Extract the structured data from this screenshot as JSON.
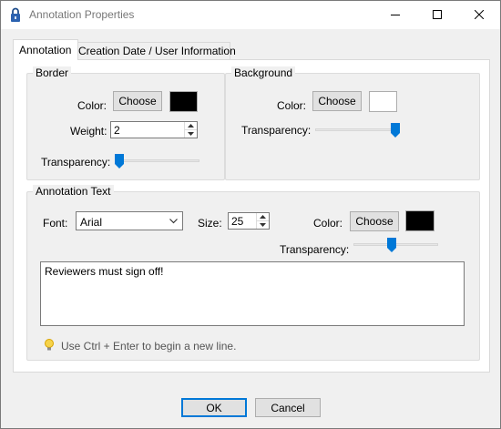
{
  "window": {
    "title": "Annotation Properties"
  },
  "tabs": [
    {
      "label": "Annotation",
      "active": true
    },
    {
      "label": "Creation Date / User Information",
      "active": false
    }
  ],
  "border": {
    "group_label": "Border",
    "color_label": "Color:",
    "choose_label": "Choose",
    "color_value": "#000000",
    "weight_label": "Weight:",
    "weight_value": "2",
    "transparency_label": "Transparency:",
    "transparency_level": 0.0
  },
  "background": {
    "group_label": "Background",
    "color_label": "Color:",
    "choose_label": "Choose",
    "color_value": "#ffffff",
    "transparency_label": "Transparency:",
    "transparency_level": 1.0
  },
  "annotation_text": {
    "group_label": "Annotation Text",
    "font_label": "Font:",
    "font_value": "Arial",
    "size_label": "Size:",
    "size_value": "25",
    "color_label": "Color:",
    "choose_label": "Choose",
    "color_value": "#000000",
    "transparency_label": "Transparency:",
    "transparency_level": 0.45,
    "text_value": "Reviewers must sign off!",
    "hint": "Use Ctrl + Enter to begin a new line.",
    "hint_icon": "lightbulb-icon"
  },
  "footer": {
    "ok_label": "OK",
    "cancel_label": "Cancel"
  },
  "colors": {
    "accent": "#0078d7",
    "thumb": "#0078d7"
  }
}
